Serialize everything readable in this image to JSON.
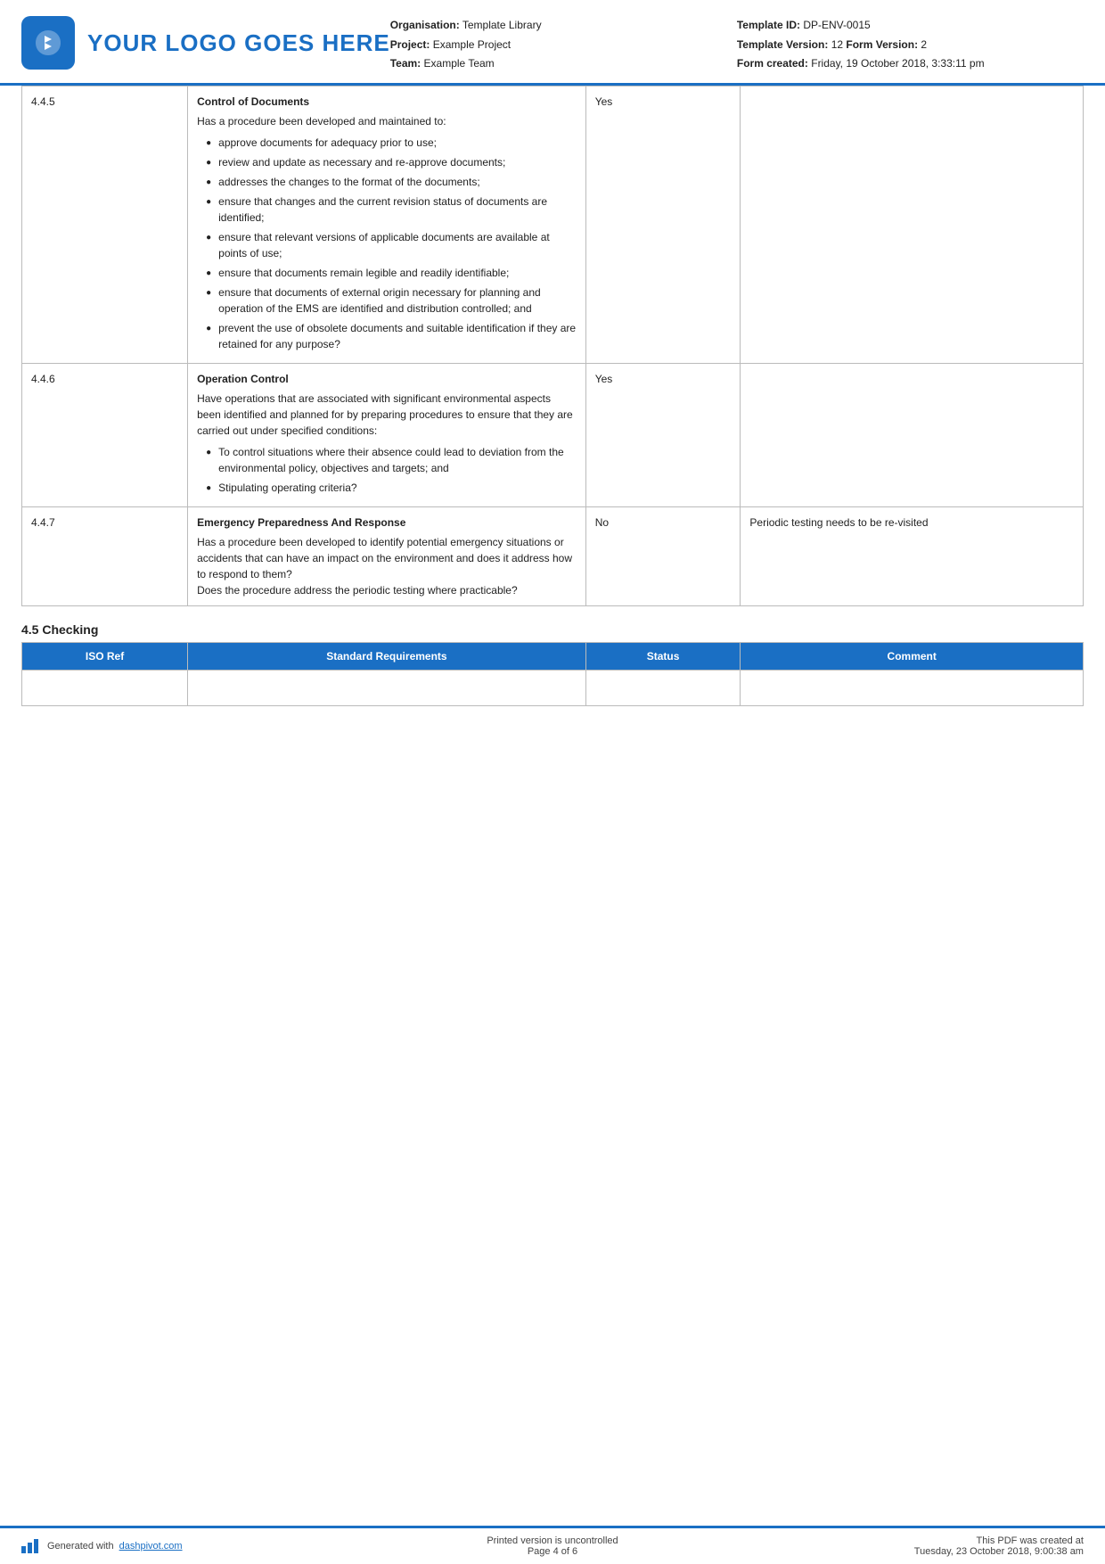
{
  "header": {
    "logo_text": "YOUR LOGO GOES HERE",
    "org_label": "Organisation:",
    "org_value": "Template Library",
    "project_label": "Project:",
    "project_value": "Example Project",
    "team_label": "Team:",
    "team_value": "Example Team",
    "template_id_label": "Template ID:",
    "template_id_value": "DP-ENV-0015",
    "template_version_label": "Template Version:",
    "template_version_value": "12",
    "form_version_label": "Form Version:",
    "form_version_value": "2",
    "form_created_label": "Form created:",
    "form_created_value": "Friday, 19 October 2018, 3:33:11 pm"
  },
  "table": {
    "headers": [
      "ISO Ref",
      "Standard Requirements",
      "Status",
      "Comment"
    ],
    "rows": [
      {
        "ref": "4.4.5",
        "title": "Control of Documents",
        "body": "Has a procedure been developed and maintained to:",
        "bullets": [
          "approve documents for adequacy prior to use;",
          "review and update as necessary and re-approve documents;",
          "addresses the changes to the format of the documents;",
          "ensure that changes and the current revision status of documents are identified;",
          "ensure that relevant versions of applicable documents are available at points of use;",
          "ensure that documents remain legible and readily identifiable;",
          "ensure that documents of external origin necessary for planning and operation of the EMS are identified and distribution controlled; and",
          "prevent the use of obsolete documents and suitable identification if they are retained for any purpose?"
        ],
        "status": "Yes",
        "comment": ""
      },
      {
        "ref": "4.4.6",
        "title": "Operation Control",
        "body": "Have operations that are associated with significant environmental aspects been identified and planned for by preparing procedures to ensure that they are carried out under specified conditions:",
        "bullets": [
          "To control situations where their absence could lead to deviation from the environmental policy, objectives and targets; and",
          "Stipulating operating criteria?"
        ],
        "status": "Yes",
        "comment": ""
      },
      {
        "ref": "4.4.7",
        "title": "Emergency Preparedness And Response",
        "body": "Has a procedure been developed to identify potential emergency situations or accidents that can have an impact on the environment and does it address how to respond to them?\nDoes the procedure address the periodic testing where practicable?",
        "bullets": [],
        "status": "No",
        "comment": "Periodic testing needs to be re-visited"
      }
    ]
  },
  "section_45": {
    "title": "4.5 Checking",
    "table_headers": [
      "ISO Ref",
      "Standard Requirements",
      "Status",
      "Comment"
    ]
  },
  "footer": {
    "generated_text": "Generated with",
    "link_text": "dashpivot.com",
    "center_text": "Printed version is uncontrolled\nPage 4 of 6",
    "right_text": "This PDF was created at\nTuesday, 23 October 2018, 9:00:38 am"
  }
}
